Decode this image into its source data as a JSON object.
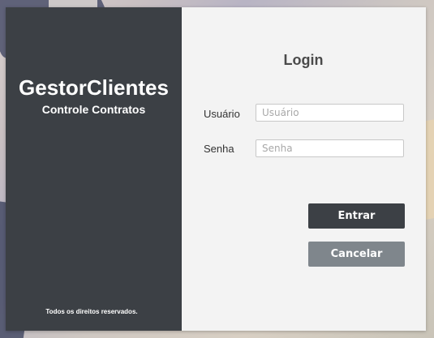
{
  "brand": {
    "title": "GestorClientes",
    "subtitle": "Controle Contratos",
    "footer": "Todos os direitos reservados."
  },
  "login": {
    "heading": "Login",
    "user_label": "Usuário",
    "user_placeholder": "Usuário",
    "password_label": "Senha",
    "password_placeholder": "Senha",
    "submit_label": "Entrar",
    "cancel_label": "Cancelar"
  },
  "colors": {
    "sidebar_bg": "#3c4045",
    "panel_bg": "#f3f3f3",
    "primary_button": "#3c4045",
    "secondary_button": "#7f868c"
  }
}
